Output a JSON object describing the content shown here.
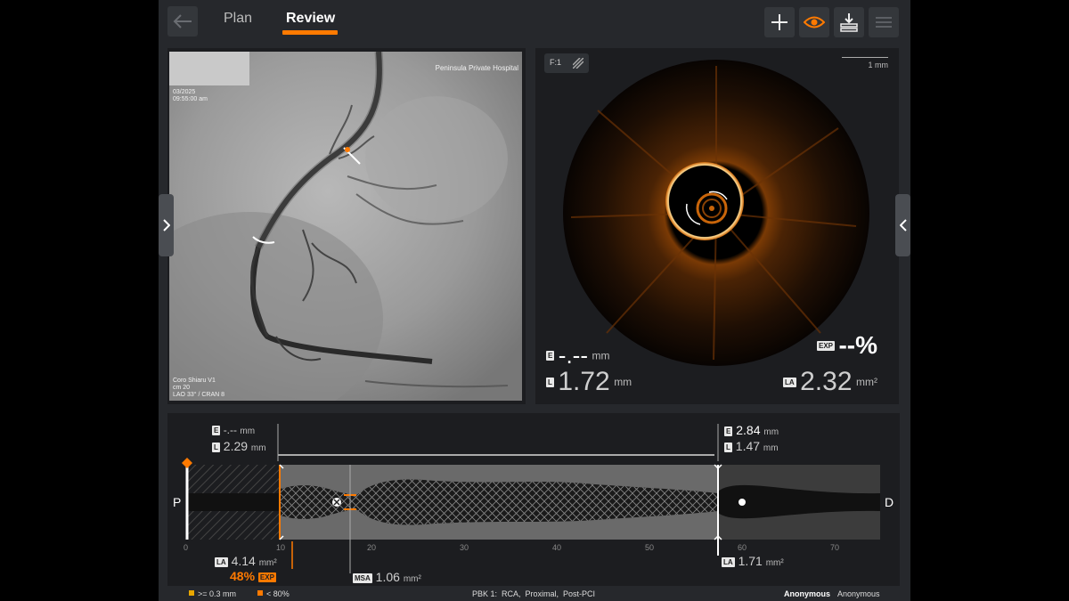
{
  "nav": {
    "tabs": [
      {
        "label": "Plan",
        "active": false
      },
      {
        "label": "Review",
        "active": true
      }
    ],
    "accent_color": "#ff7a00",
    "toolbar_icons": [
      "plus-icon",
      "eye-icon",
      "download-icon",
      "menu-icon"
    ]
  },
  "angio": {
    "hospital": "Peninsula Private Hospital",
    "date": "03/2025",
    "time": "09:55:00 am",
    "overlay_lines": [
      "Coro Shiaru V1",
      "cm 20",
      "LAO 33° / CRAN 8"
    ]
  },
  "oct": {
    "frame_label": "F:1",
    "scale_label": "1 mm",
    "ext_value": "-.--",
    "ext_unit": "mm",
    "exp_value": "--%",
    "lumen_value": "1.72",
    "lumen_unit": "mm",
    "area_value": "2.32",
    "area_unit": "mm²",
    "tags": {
      "e": "E",
      "l": "L",
      "exp": "EXP",
      "la": "LA"
    }
  },
  "longitudinal": {
    "proximal_label": "P",
    "distal_label": "D",
    "ticks": [
      "0",
      "10",
      "20",
      "30",
      "40",
      "50",
      "60",
      "70"
    ],
    "left_e": "-.--",
    "left_l": "2.29",
    "right_e": "2.84",
    "right_l": "1.47",
    "unit_mm": "mm",
    "unit_mm2": "mm²",
    "left_la": "4.14",
    "left_exp": "48%",
    "msa_label": "MSA",
    "msa_value": "1.06",
    "right_la": "1.71"
  },
  "status": {
    "legend_1": ">= 0.3 mm",
    "legend_2": "< 80%",
    "procedure": "PBK 1:  RCA,  Proximal,  Post-PCI",
    "user_bold": "Anonymous",
    "user": "Anonymous"
  }
}
